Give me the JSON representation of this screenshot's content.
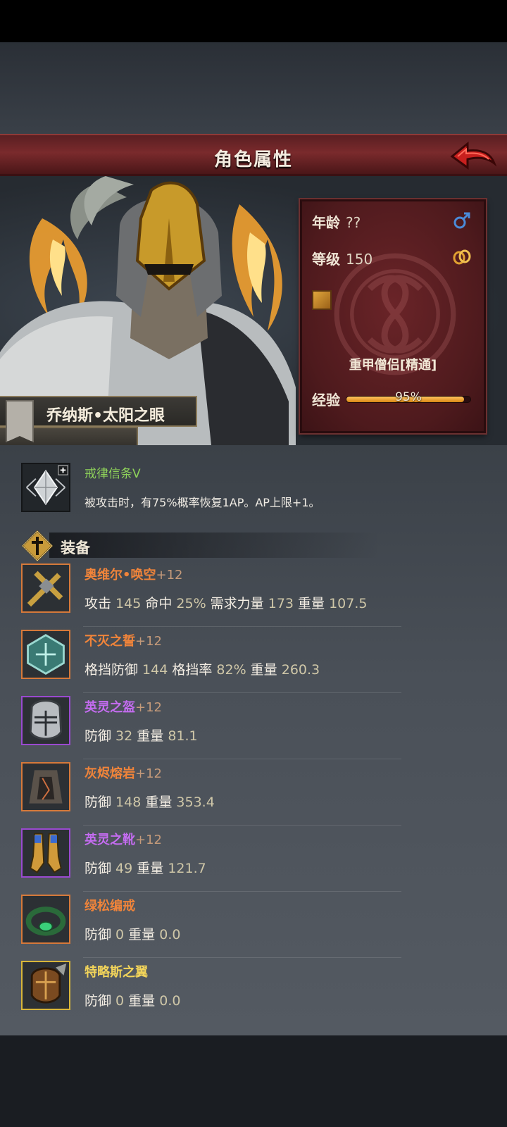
{
  "header": {
    "title": "角色属性",
    "back_label": "back-arrow-icon"
  },
  "character": {
    "name": "乔纳斯•太阳之眼",
    "age_label": "年龄",
    "age_value": "??",
    "level_label": "等级",
    "level_value": "150",
    "class_name": "重甲僧侣[精通]",
    "exp_label": "经验",
    "exp_text": "95%",
    "exp_percent": 95
  },
  "skill": {
    "name": "戒律信条V",
    "description": "被攻击时，有75%概率恢复1AP。AP上限+1。"
  },
  "section": {
    "title": "装备"
  },
  "equipment": [
    {
      "name": "奥维尔•唤空",
      "enh": "+12",
      "color": "#f0843a",
      "border": "#d6793a",
      "stats": [
        [
          "攻击",
          "145"
        ],
        [
          "命中",
          "25%"
        ],
        [
          "需求力量",
          "173"
        ],
        [
          "重量",
          "107.5"
        ]
      ]
    },
    {
      "name": "不灭之誓",
      "enh": "+12",
      "color": "#f0843a",
      "border": "#d6793a",
      "stats": [
        [
          "格挡防御",
          "144"
        ],
        [
          "格挡率",
          "82%"
        ],
        [
          "重量",
          "260.3"
        ]
      ]
    },
    {
      "name": "英灵之盔",
      "enh": "+12",
      "color": "#c46cf0",
      "border": "#9a4ad0",
      "stats": [
        [
          "防御",
          "32"
        ],
        [
          "重量",
          "81.1"
        ]
      ]
    },
    {
      "name": "灰烬熔岩",
      "enh": "+12",
      "color": "#f0843a",
      "border": "#d6793a",
      "stats": [
        [
          "防御",
          "148"
        ],
        [
          "重量",
          "353.4"
        ]
      ]
    },
    {
      "name": "英灵之靴",
      "enh": "+12",
      "color": "#c46cf0",
      "border": "#9a4ad0",
      "stats": [
        [
          "防御",
          "49"
        ],
        [
          "重量",
          "121.7"
        ]
      ]
    },
    {
      "name": "绿松编戒",
      "enh": "",
      "color": "#f0843a",
      "border": "#d6793a",
      "stats": [
        [
          "防御",
          "0"
        ],
        [
          "重量",
          "0.0"
        ]
      ]
    },
    {
      "name": "特略斯之翼",
      "enh": "",
      "color": "#f2d45a",
      "border": "#d8b63a",
      "stats": [
        [
          "防御",
          "0"
        ],
        [
          "重量",
          "0.0"
        ]
      ]
    }
  ]
}
